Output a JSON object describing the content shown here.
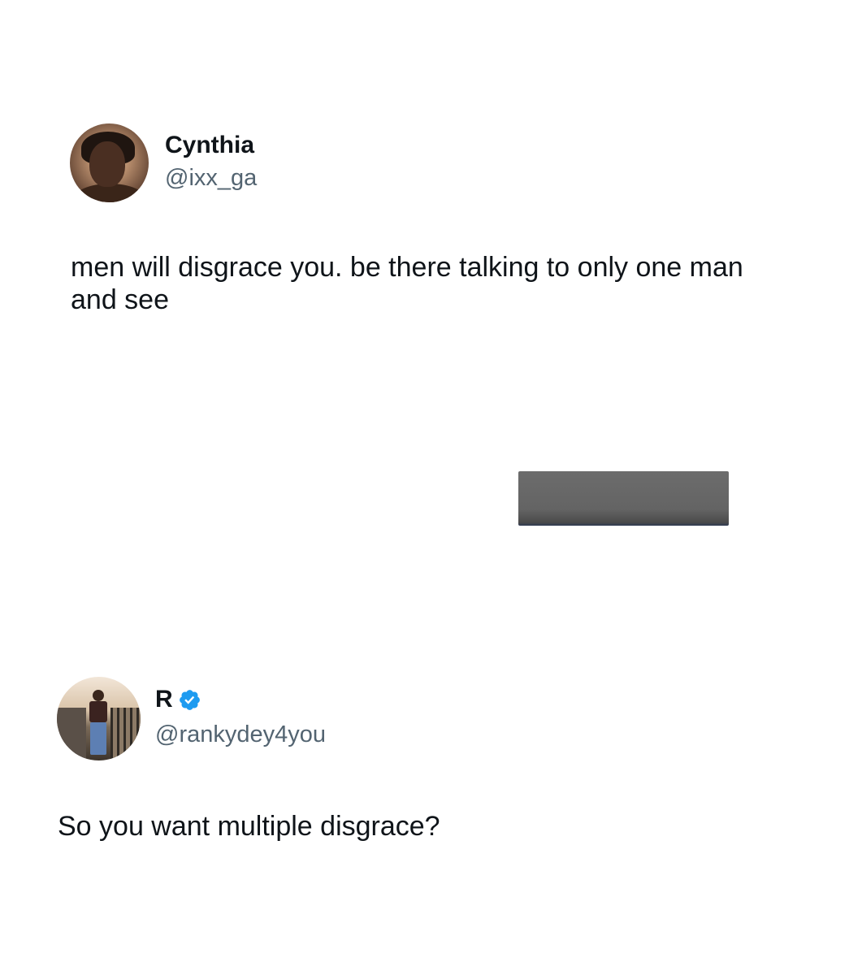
{
  "tweets": [
    {
      "display_name": "Cynthia",
      "handle": "@ixx_ga",
      "verified": false,
      "text": "men will disgrace you. be there talking to only one man and see"
    },
    {
      "display_name": "R",
      "handle": "@rankydey4you",
      "verified": true,
      "text": "So you want multiple disgrace?"
    }
  ],
  "colors": {
    "text_primary": "#0f1419",
    "text_secondary": "#536471",
    "verified_badge": "#1d9bf0",
    "redaction_block": "#666666",
    "background": "#ffffff"
  }
}
